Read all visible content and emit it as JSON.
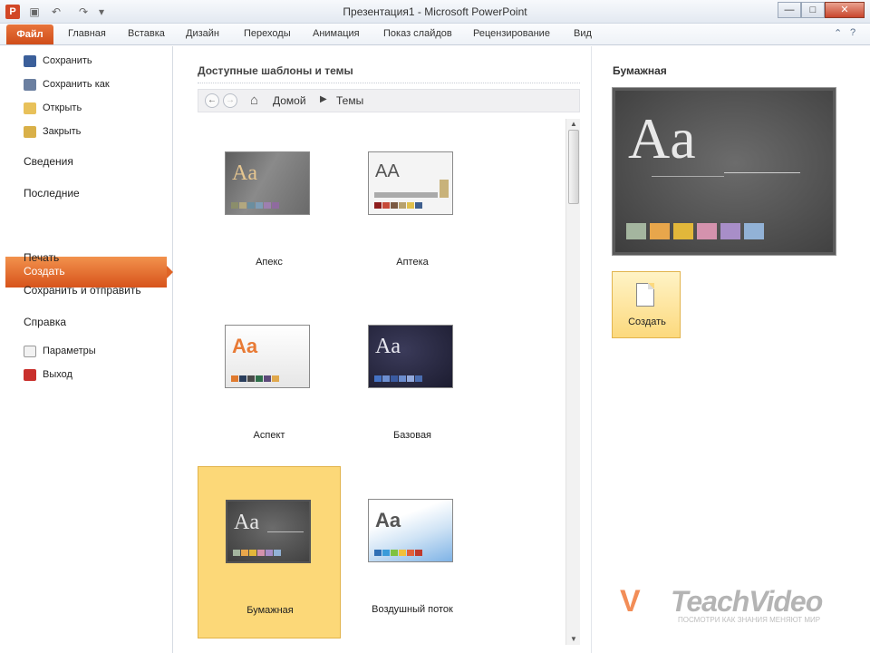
{
  "window": {
    "title": "Презентация1 - Microsoft PowerPoint",
    "app_icon": "P",
    "min": "—",
    "max": "□",
    "close": "✕"
  },
  "ribbon": {
    "file_tab": "Файл",
    "tabs": [
      "Главная",
      "Вставка",
      "Дизайн",
      "Переходы",
      "Анимация",
      "Показ слайдов",
      "Рецензирование",
      "Вид"
    ],
    "help": "?"
  },
  "backstage": {
    "small_items": [
      {
        "label": "Сохранить",
        "icon": "save-icon"
      },
      {
        "label": "Сохранить как",
        "icon": "save-as-icon"
      },
      {
        "label": "Открыть",
        "icon": "open-folder-icon"
      },
      {
        "label": "Закрыть",
        "icon": "close-folder-icon"
      }
    ],
    "big_items": [
      "Сведения",
      "Последние",
      "Создать",
      "Печать",
      "Сохранить и отправить",
      "Справка"
    ],
    "active": "Создать",
    "bottom_items": [
      {
        "label": "Параметры",
        "icon": "options-icon"
      },
      {
        "label": "Выход",
        "icon": "exit-icon"
      }
    ]
  },
  "templates": {
    "section_title": "Доступные шаблоны и темы",
    "breadcrumb": [
      "Домой",
      "Темы"
    ],
    "items": [
      {
        "name": "Апекс",
        "selected": false,
        "colors": [
          "#8b8e6b",
          "#b2a77f",
          "#6b8e9f",
          "#7e9db7",
          "#9e7fb0",
          "#8f6b9f"
        ]
      },
      {
        "name": "Аптека",
        "selected": false,
        "colors": [
          "#8e1d1d",
          "#c64a39",
          "#7b5a42",
          "#b7a16e",
          "#e0c04c",
          "#3f5f8e"
        ]
      },
      {
        "name": "Аспект",
        "selected": false,
        "colors": [
          "#e07a2e",
          "#2a3e5c",
          "#4a4a4a",
          "#2f6f4a",
          "#5d4a7a",
          "#e0a84c"
        ]
      },
      {
        "name": "Базовая",
        "selected": false,
        "colors": [
          "#4472c4",
          "#6d8fd1",
          "#3a5aa0",
          "#6b8ccd",
          "#92a9dc",
          "#4a6db0"
        ]
      },
      {
        "name": "Бумажная",
        "selected": true,
        "colors": [
          "#a4b59f",
          "#e8a64b",
          "#e2b73a",
          "#d492ad",
          "#a88ec8",
          "#92b2d6"
        ]
      },
      {
        "name": "Воздушный поток",
        "selected": false,
        "colors": [
          "#2f6fb5",
          "#3a9bd9",
          "#7fc241",
          "#f2c03a",
          "#e0603a",
          "#c0392b"
        ]
      }
    ]
  },
  "preview": {
    "title": "Бумажная",
    "sample_text": "Aa",
    "colors": [
      "#a4b59f",
      "#e8a64b",
      "#e2b73a",
      "#d492ad",
      "#a88ec8",
      "#92b2d6"
    ],
    "create_label": "Создать"
  },
  "watermark": {
    "logo": "V",
    "name": "TeachVideo",
    "tagline": "ПОСМОТРИ КАК ЗНАНИЯ МЕНЯЮТ МИР"
  }
}
